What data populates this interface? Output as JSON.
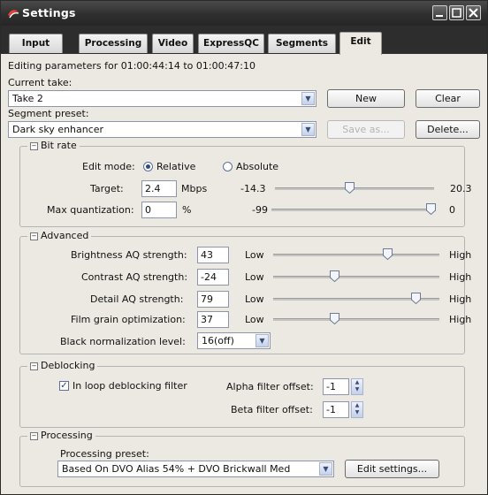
{
  "window": {
    "title": "Settings",
    "min_icon": "minimize-icon",
    "max_icon": "maximize-icon",
    "close_icon": "close-icon"
  },
  "tabs": [
    "Input",
    "Processing",
    "Video",
    "ExpressQC",
    "Segments",
    "Edit"
  ],
  "active_tab": "Edit",
  "editing": {
    "text": "Editing parameters for 01:00:44:14 to 01:00:47:10"
  },
  "current_take": {
    "label": "Current take:",
    "value": "Take 2",
    "new_label": "New",
    "clear_label": "Clear"
  },
  "segment_preset": {
    "label": "Segment preset:",
    "value": "Dark sky enhancer",
    "save_label": "Save as...",
    "delete_label": "Delete..."
  },
  "bitrate": {
    "title": "Bit rate",
    "edit_mode_label": "Edit mode:",
    "relative_label": "Relative",
    "absolute_label": "Absolute",
    "selected_mode": "Relative",
    "target_label": "Target:",
    "target_value": "2.4",
    "target_unit": "Mbps",
    "target_min": "-14.3",
    "target_max": "20.3",
    "target_slider": 0.47,
    "maxq_label": "Max quantization:",
    "maxq_value": "0",
    "maxq_unit": "%",
    "maxq_min": "-99",
    "maxq_max": "0",
    "maxq_slider": 1.0
  },
  "advanced": {
    "title": "Advanced",
    "low_label": "Low",
    "high_label": "High",
    "rows": [
      {
        "label": "Brightness AQ strength:",
        "value": "43",
        "slider": 0.7
      },
      {
        "label": "Contrast AQ strength:",
        "value": "-24",
        "slider": 0.36
      },
      {
        "label": "Detail AQ strength:",
        "value": "79",
        "slider": 0.88
      },
      {
        "label": "Film grain optimization:",
        "value": "37",
        "slider": 0.36
      }
    ],
    "black_label": "Black normalization level:",
    "black_value": "16(off)"
  },
  "deblocking": {
    "title": "Deblocking",
    "loop_label": "In loop deblocking filter",
    "loop_checked": true,
    "alpha_label": "Alpha filter offset:",
    "alpha_value": "-1",
    "beta_label": "Beta filter offset:",
    "beta_value": "-1"
  },
  "processing": {
    "title": "Processing",
    "preset_label": "Processing preset:",
    "preset_value": "Based On DVO Alias 54% + DVO Brickwall Med",
    "edit_label": "Edit settings..."
  }
}
